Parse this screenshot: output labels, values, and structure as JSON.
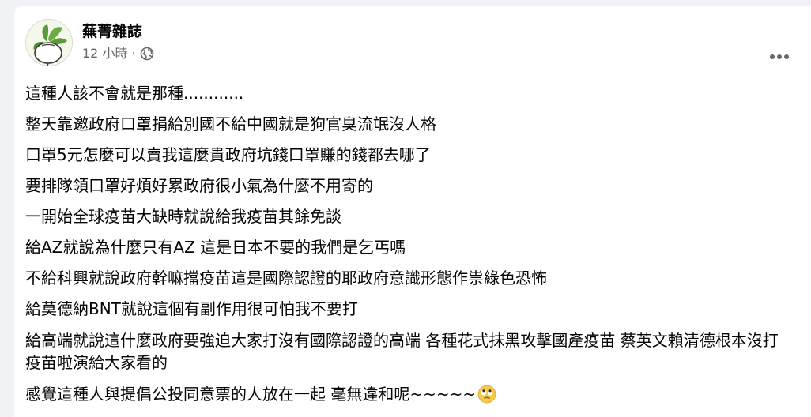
{
  "post": {
    "author": "蕪菁雜誌",
    "time": "12 小時",
    "separator": "·",
    "audience_icon": "globe-icon",
    "more_icon": "more-options-icon",
    "lines": [
      "這種人該不會就是那種............",
      "整天靠邀政府口罩捐給別國不給中國就是狗官臭流氓沒人格",
      "口罩5元怎麼可以賣我這麼貴政府坑錢口罩賺的錢都去哪了",
      "要排隊領口罩好煩好累政府很小氣為什麼不用寄的",
      "一開始全球疫苗大缺時就說給我疫苗其餘免談",
      "給AZ就說為什麼只有AZ 這是日本不要的我們是乞丐嗎",
      "不給科興就說政府幹嘛擋疫苗這是國際認證的耶政府意識形態作祟綠色恐怖",
      "給莫德納BNT就說這個有副作用很可怕我不要打",
      "給高端就說這什麼政府要強迫大家打沒有國際認證的高端 各種花式抹黑攻擊國產疫苗 蔡英文賴清德根本沒打疫苗啦演給大家看的",
      "感覺這種人與提倡公投同意票的人放在一起 毫無違和呢~~~~~"
    ],
    "last_line_emoji": "eye-roll-emoji"
  }
}
